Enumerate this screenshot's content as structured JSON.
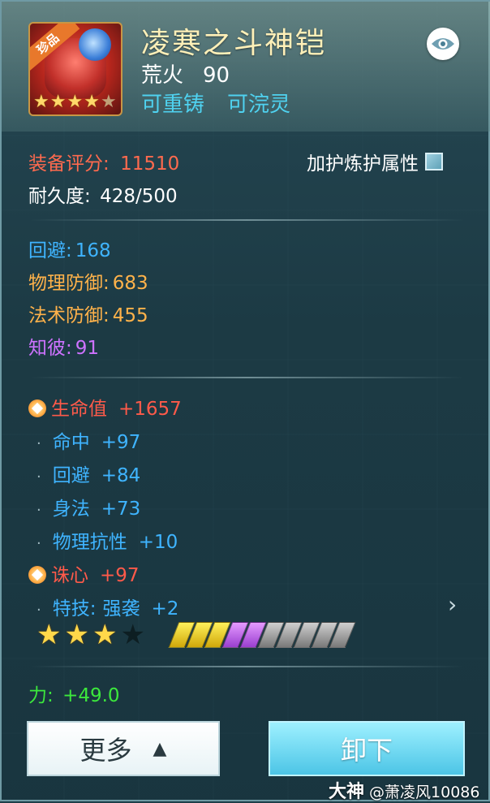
{
  "item": {
    "rarity_badge": "珍品",
    "name": "凌寒之斗神铠",
    "type": "荒火",
    "level": "90",
    "tag_reforge": "可重铸",
    "tag_infuse": "可浣灵",
    "icon_stars_lit": 4,
    "icon_stars_total": 5
  },
  "score": {
    "label": "装备评分:",
    "value": "11510"
  },
  "durability": {
    "label": "耐久度:",
    "value": "428/500"
  },
  "protect_toggle": {
    "label": "加护炼护属性",
    "checked": false
  },
  "base_stats": [
    {
      "label": "回避:",
      "value": "168",
      "color": "#3fb4ff"
    },
    {
      "label": "物理防御:",
      "value": "683",
      "color": "#ffb24a"
    },
    {
      "label": "法术防御:",
      "value": "455",
      "color": "#ffb24a"
    },
    {
      "label": "知彼:",
      "value": "91",
      "color": "#cd72ff"
    }
  ],
  "extra_stats": [
    {
      "label": "生命值",
      "value": "+1657",
      "gem": true
    },
    {
      "label": "命中",
      "value": "+97",
      "gem": false
    },
    {
      "label": "回避",
      "value": "+84",
      "gem": false
    },
    {
      "label": "身法",
      "value": "+73",
      "gem": false
    },
    {
      "label": "物理抗性",
      "value": "+10",
      "gem": false
    },
    {
      "label": "诛心",
      "value": "+97",
      "gem": true
    },
    {
      "label": "特技:",
      "value_name": "强袭",
      "value": "+2",
      "gem": false
    }
  ],
  "refine": {
    "stars_lit": 3,
    "stars_total": 4,
    "bars_yellow": 3,
    "bars_purple": 2,
    "bars_total": 10
  },
  "strength": {
    "label": "力:",
    "value": "+49.0"
  },
  "buttons": {
    "more": "更多",
    "unequip": "卸下"
  },
  "watermark": {
    "brand": "大神",
    "handle": "@萧凌风10086"
  },
  "colors": {
    "accent_blue": "#4fd2f0",
    "score_red": "#ff6a4e",
    "gem_red": "#ff5a4a",
    "stat_blue": "#3fb4ff",
    "strength_green": "#3ce83c"
  }
}
